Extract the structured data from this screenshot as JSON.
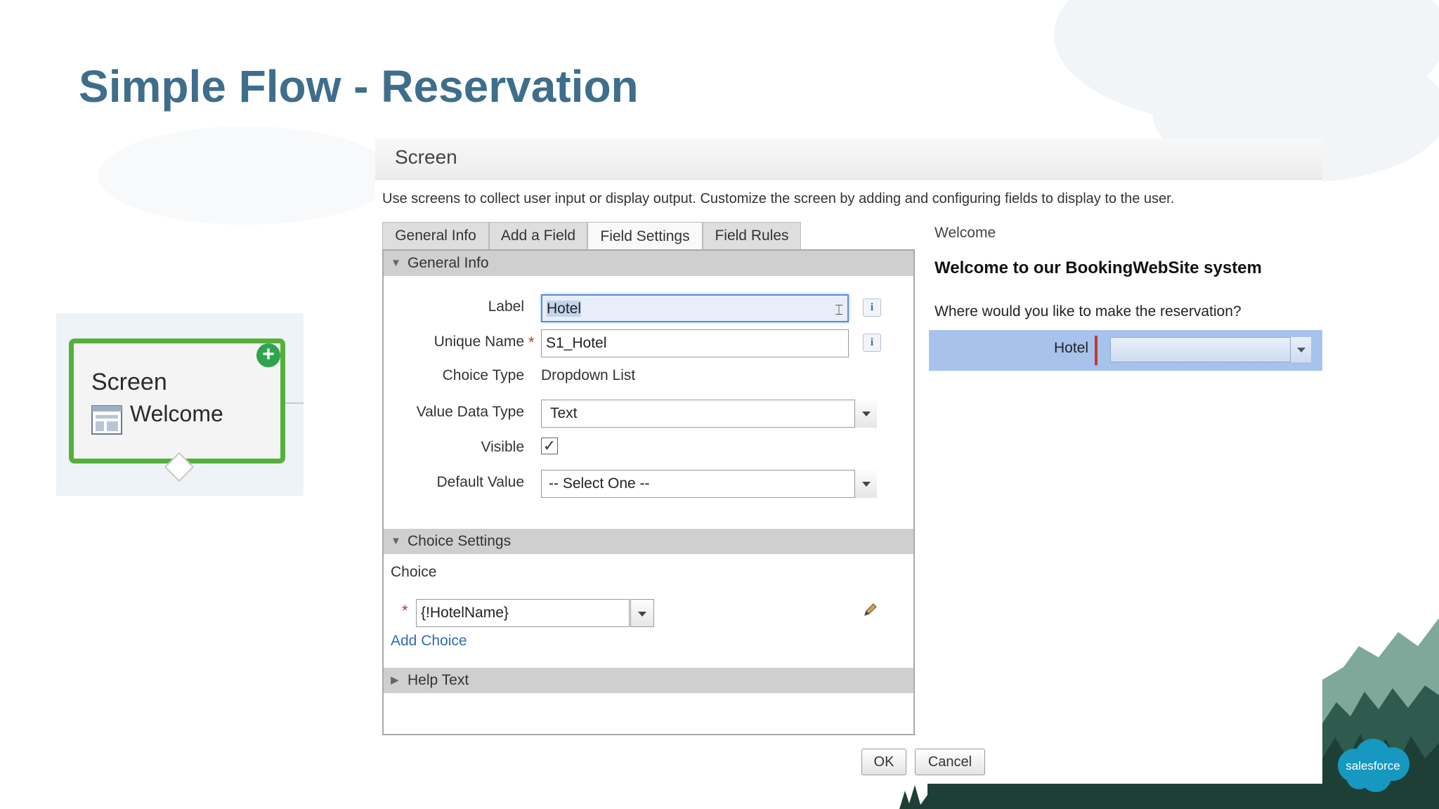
{
  "slide": {
    "title": "Simple Flow - Reservation"
  },
  "node": {
    "type": "Screen",
    "name": "Welcome"
  },
  "dialog": {
    "title": "Screen",
    "description": "Use screens to collect user input or display output. Customize the screen by adding and configuring fields to display to the user.",
    "tabs": [
      "General Info",
      "Add a Field",
      "Field Settings",
      "Field Rules"
    ],
    "active_tab": "Field Settings",
    "general_info": {
      "section_label": "General Info",
      "label_label": "Label",
      "label_value": "Hotel",
      "unique_name_label": "Unique Name",
      "unique_name_value": "S1_Hotel",
      "choice_type_label": "Choice Type",
      "choice_type_value": "Dropdown List",
      "value_data_type_label": "Value Data Type",
      "value_data_type_value": "Text",
      "visible_label": "Visible",
      "visible_checked": true,
      "default_value_label": "Default Value",
      "default_value_value": "-- Select One --"
    },
    "choice_settings": {
      "section_label": "Choice Settings",
      "choice_label": "Choice",
      "choice_value": "{!HotelName}",
      "add_choice": "Add Choice"
    },
    "help_text": {
      "section_label": "Help Text"
    },
    "ok_label": "OK",
    "cancel_label": "Cancel"
  },
  "preview": {
    "screen_name": "Welcome",
    "heading": "Welcome to our BookingWebSite system",
    "question": "Where would you like to make the reservation?",
    "field_label": "Hotel"
  },
  "brand": {
    "logo_text": "salesforce"
  },
  "colors": {
    "title": "#3e6e8c",
    "node_border": "#55b03a",
    "link": "#2f6db3",
    "required": "#c23934",
    "preview_highlight": "#a7c3ec",
    "brand": "#1798c1"
  }
}
